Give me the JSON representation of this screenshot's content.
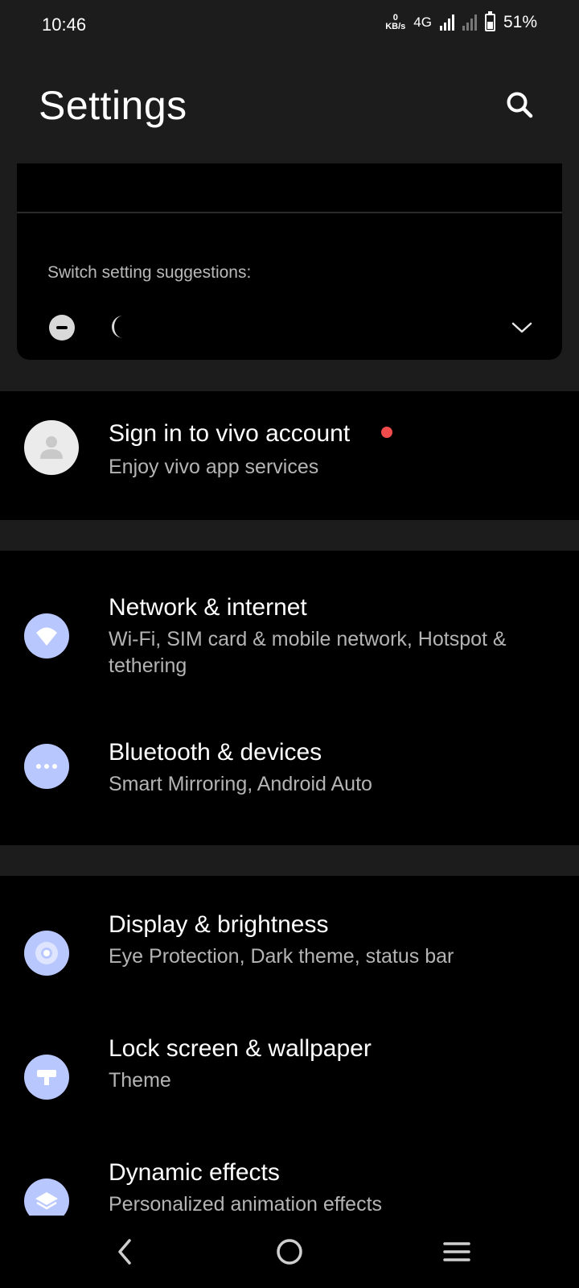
{
  "status_bar": {
    "time": "10:46",
    "speed_value": "0",
    "speed_unit": "KB/s",
    "network_type": "4G",
    "battery": "51%"
  },
  "header": {
    "title": "Settings",
    "search_icon": "search-icon"
  },
  "suggestions": {
    "label": "Switch setting suggestions:",
    "icons": [
      "do-not-disturb-icon",
      "moon-icon"
    ],
    "expand_icon": "chevron-down-icon"
  },
  "account": {
    "title": "Sign in to vivo account",
    "subtitle": "Enjoy vivo app services",
    "icon": "avatar-icon",
    "badge_color": "#f24b4b"
  },
  "items": [
    {
      "title": "Network & internet",
      "subtitle": "Wi-Fi, SIM card & mobile network, Hotspot & tethering",
      "icon": "wifi-icon"
    },
    {
      "title": "Bluetooth & devices",
      "subtitle": "Smart Mirroring, Android Auto",
      "icon": "more-dots-icon"
    },
    {
      "title": "Display & brightness",
      "subtitle": "Eye Protection, Dark theme, status bar",
      "icon": "brightness-icon"
    },
    {
      "title": "Lock screen & wallpaper",
      "subtitle": "Theme",
      "icon": "paint-roller-icon"
    },
    {
      "title": "Dynamic effects",
      "subtitle": "Personalized animation effects",
      "icon": "layers-icon"
    }
  ],
  "nav_bar": {
    "back_icon": "back-icon",
    "home_icon": "home-icon",
    "menu_icon": "menu-icon"
  },
  "colors": {
    "accent_icon_bg": "#b9c7ff",
    "background": "#000000",
    "header_bg": "#1c1c1c"
  }
}
